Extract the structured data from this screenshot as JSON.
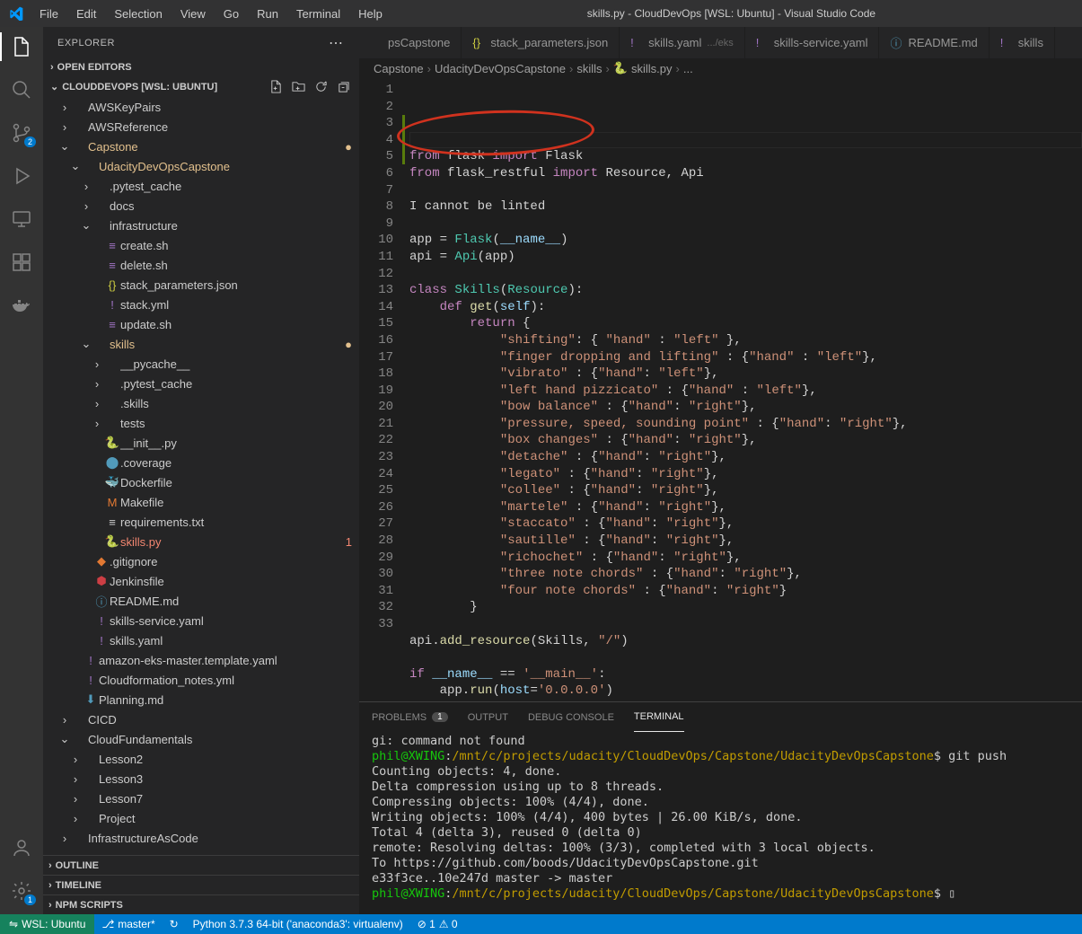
{
  "title": "skills.py - CloudDevOps [WSL: Ubuntu] - Visual Studio Code",
  "menu": [
    "File",
    "Edit",
    "Selection",
    "View",
    "Go",
    "Run",
    "Terminal",
    "Help"
  ],
  "activity": {
    "scm_badge": "2",
    "settings_badge": "1"
  },
  "sidebar": {
    "title": "EXPLORER",
    "open_editors": "OPEN EDITORS",
    "root": "CLOUDDEVOPS [WSL: UBUNTU]",
    "outline": "OUTLINE",
    "timeline": "TIMELINE",
    "npm": "NPM SCRIPTS",
    "tree": [
      {
        "d": 1,
        "t": "folder",
        "open": false,
        "name": "AWSKeyPairs"
      },
      {
        "d": 1,
        "t": "folder",
        "open": false,
        "name": "AWSReference"
      },
      {
        "d": 1,
        "t": "folder",
        "open": true,
        "name": "Capstone",
        "hl": "capstone",
        "mod": true
      },
      {
        "d": 2,
        "t": "folder",
        "open": true,
        "name": "UdacityDevOpsCapstone",
        "hl": "capstone"
      },
      {
        "d": 3,
        "t": "folder",
        "open": false,
        "name": ".pytest_cache"
      },
      {
        "d": 3,
        "t": "folder",
        "open": false,
        "name": "docs"
      },
      {
        "d": 3,
        "t": "folder",
        "open": true,
        "name": "infrastructure"
      },
      {
        "d": 4,
        "t": "file",
        "ic": "sh",
        "name": "create.sh"
      },
      {
        "d": 4,
        "t": "file",
        "ic": "sh",
        "name": "delete.sh"
      },
      {
        "d": 4,
        "t": "file",
        "ic": "json",
        "name": "stack_parameters.json"
      },
      {
        "d": 4,
        "t": "file",
        "ic": "yml",
        "name": "stack.yml"
      },
      {
        "d": 4,
        "t": "file",
        "ic": "sh",
        "name": "update.sh"
      },
      {
        "d": 3,
        "t": "folder",
        "open": true,
        "name": "skills",
        "hl": "skills",
        "mod": true
      },
      {
        "d": 4,
        "t": "folder",
        "open": false,
        "name": "__pycache__"
      },
      {
        "d": 4,
        "t": "folder",
        "open": false,
        "name": ".pytest_cache"
      },
      {
        "d": 4,
        "t": "folder",
        "open": false,
        "name": ".skills"
      },
      {
        "d": 4,
        "t": "folder",
        "open": false,
        "name": "tests"
      },
      {
        "d": 4,
        "t": "file",
        "ic": "py",
        "name": "__init__.py"
      },
      {
        "d": 4,
        "t": "file",
        "ic": "cov",
        "name": ".coverage"
      },
      {
        "d": 4,
        "t": "file",
        "ic": "dk",
        "name": "Dockerfile"
      },
      {
        "d": 4,
        "t": "file",
        "ic": "mk",
        "name": "Makefile"
      },
      {
        "d": 4,
        "t": "file",
        "ic": "txt",
        "name": "requirements.txt"
      },
      {
        "d": 4,
        "t": "file",
        "ic": "py",
        "name": "skills.py",
        "hl": "err",
        "badge": "1"
      },
      {
        "d": 3,
        "t": "file",
        "ic": "git",
        "name": ".gitignore"
      },
      {
        "d": 3,
        "t": "file",
        "ic": "jk",
        "name": "Jenkinsfile"
      },
      {
        "d": 3,
        "t": "file",
        "ic": "info",
        "name": "README.md"
      },
      {
        "d": 3,
        "t": "file",
        "ic": "yml",
        "name": "skills-service.yaml"
      },
      {
        "d": 3,
        "t": "file",
        "ic": "yml",
        "name": "skills.yaml"
      },
      {
        "d": 2,
        "t": "file",
        "ic": "yml",
        "name": "amazon-eks-master.template.yaml"
      },
      {
        "d": 2,
        "t": "file",
        "ic": "yml",
        "name": "Cloudformation_notes.yml"
      },
      {
        "d": 2,
        "t": "file",
        "ic": "md",
        "name": "Planning.md"
      },
      {
        "d": 1,
        "t": "folder",
        "open": false,
        "name": "CICD"
      },
      {
        "d": 1,
        "t": "folder",
        "open": true,
        "name": "CloudFundamentals"
      },
      {
        "d": 2,
        "t": "folder",
        "open": false,
        "name": "Lesson2"
      },
      {
        "d": 2,
        "t": "folder",
        "open": false,
        "name": "Lesson3"
      },
      {
        "d": 2,
        "t": "folder",
        "open": false,
        "name": "Lesson7"
      },
      {
        "d": 2,
        "t": "folder",
        "open": false,
        "name": "Project"
      },
      {
        "d": 1,
        "t": "folder",
        "open": false,
        "name": "InfrastructureAsCode"
      }
    ]
  },
  "tabs": [
    {
      "ic": "",
      "label": "psCapstone",
      "short": true
    },
    {
      "ic": "json",
      "label": "stack_parameters.json"
    },
    {
      "ic": "yml",
      "label": "skills.yaml",
      "desc": ".../eks"
    },
    {
      "ic": "yml",
      "label": "skills-service.yaml"
    },
    {
      "ic": "info",
      "label": "README.md"
    },
    {
      "ic": "yml",
      "label": "skills",
      "short": true
    }
  ],
  "breadcrumb": [
    "Capstone",
    "UdacityDevOpsCapstone",
    "skills",
    "skills.py",
    "..."
  ],
  "code": {
    "lines": 33,
    "content": [
      [
        [
          "kw",
          "from"
        ],
        [
          "",
          " flask "
        ],
        [
          "kw",
          "import"
        ],
        [
          "",
          " Flask"
        ]
      ],
      [
        [
          "kw",
          "from"
        ],
        [
          "",
          " flask_restful "
        ],
        [
          "kw",
          "import"
        ],
        [
          "",
          " Resource, Api"
        ]
      ],
      [],
      [
        [
          "",
          "I cannot be linted"
        ]
      ],
      [],
      [
        [
          "",
          "app "
        ],
        [
          "op",
          "="
        ],
        [
          "",
          " "
        ],
        [
          "cls",
          "Flask"
        ],
        [
          "op",
          "("
        ],
        [
          "var",
          "__name__"
        ],
        [
          "op",
          ")"
        ]
      ],
      [
        [
          "",
          "api "
        ],
        [
          "op",
          "="
        ],
        [
          "",
          " "
        ],
        [
          "cls",
          "Api"
        ],
        [
          "op",
          "("
        ],
        [
          "",
          "app"
        ],
        [
          "op",
          ")"
        ]
      ],
      [],
      [
        [
          "kw",
          "class"
        ],
        [
          "",
          " "
        ],
        [
          "cls",
          "Skills"
        ],
        [
          "op",
          "("
        ],
        [
          "cls",
          "Resource"
        ],
        [
          "op",
          "):"
        ]
      ],
      [
        [
          "",
          "    "
        ],
        [
          "kw",
          "def"
        ],
        [
          "",
          " "
        ],
        [
          "fn",
          "get"
        ],
        [
          "op",
          "("
        ],
        [
          "self",
          "self"
        ],
        [
          "op",
          "):"
        ]
      ],
      [
        [
          "",
          "        "
        ],
        [
          "kw",
          "return"
        ],
        [
          "",
          " {"
        ]
      ],
      [
        [
          "",
          "            "
        ],
        [
          "str",
          "\"shifting\""
        ],
        [
          "",
          ": { "
        ],
        [
          "str",
          "\"hand\""
        ],
        [
          "",
          " : "
        ],
        [
          "str",
          "\"left\""
        ],
        [
          "",
          " },"
        ]
      ],
      [
        [
          "",
          "            "
        ],
        [
          "str",
          "\"finger dropping and lifting\""
        ],
        [
          "",
          " : {"
        ],
        [
          "str",
          "\"hand\""
        ],
        [
          "",
          " : "
        ],
        [
          "str",
          "\"left\""
        ],
        [
          "",
          "},"
        ]
      ],
      [
        [
          "",
          "            "
        ],
        [
          "str",
          "\"vibrato\""
        ],
        [
          "",
          " : {"
        ],
        [
          "str",
          "\"hand\""
        ],
        [
          "",
          ": "
        ],
        [
          "str",
          "\"left\""
        ],
        [
          "",
          "},"
        ]
      ],
      [
        [
          "",
          "            "
        ],
        [
          "str",
          "\"left hand pizzicato\""
        ],
        [
          "",
          " : {"
        ],
        [
          "str",
          "\"hand\""
        ],
        [
          "",
          " : "
        ],
        [
          "str",
          "\"left\""
        ],
        [
          "",
          "},"
        ]
      ],
      [
        [
          "",
          "            "
        ],
        [
          "str",
          "\"bow balance\""
        ],
        [
          "",
          " : {"
        ],
        [
          "str",
          "\"hand\""
        ],
        [
          "",
          ": "
        ],
        [
          "str",
          "\"right\""
        ],
        [
          "",
          "},"
        ]
      ],
      [
        [
          "",
          "            "
        ],
        [
          "str",
          "\"pressure, speed, sounding point\""
        ],
        [
          "",
          " : {"
        ],
        [
          "str",
          "\"hand\""
        ],
        [
          "",
          ": "
        ],
        [
          "str",
          "\"right\""
        ],
        [
          "",
          "},"
        ]
      ],
      [
        [
          "",
          "            "
        ],
        [
          "str",
          "\"box changes\""
        ],
        [
          "",
          " : {"
        ],
        [
          "str",
          "\"hand\""
        ],
        [
          "",
          ": "
        ],
        [
          "str",
          "\"right\""
        ],
        [
          "",
          "},"
        ]
      ],
      [
        [
          "",
          "            "
        ],
        [
          "str",
          "\"detache\""
        ],
        [
          "",
          " : {"
        ],
        [
          "str",
          "\"hand\""
        ],
        [
          "",
          ": "
        ],
        [
          "str",
          "\"right\""
        ],
        [
          "",
          "},"
        ]
      ],
      [
        [
          "",
          "            "
        ],
        [
          "str",
          "\"legato\""
        ],
        [
          "",
          " : {"
        ],
        [
          "str",
          "\"hand\""
        ],
        [
          "",
          ": "
        ],
        [
          "str",
          "\"right\""
        ],
        [
          "",
          "},"
        ]
      ],
      [
        [
          "",
          "            "
        ],
        [
          "str",
          "\"collee\""
        ],
        [
          "",
          " : {"
        ],
        [
          "str",
          "\"hand\""
        ],
        [
          "",
          ": "
        ],
        [
          "str",
          "\"right\""
        ],
        [
          "",
          "},"
        ]
      ],
      [
        [
          "",
          "            "
        ],
        [
          "str",
          "\"martele\""
        ],
        [
          "",
          " : {"
        ],
        [
          "str",
          "\"hand\""
        ],
        [
          "",
          ": "
        ],
        [
          "str",
          "\"right\""
        ],
        [
          "",
          "},"
        ]
      ],
      [
        [
          "",
          "            "
        ],
        [
          "str",
          "\"staccato\""
        ],
        [
          "",
          " : {"
        ],
        [
          "str",
          "\"hand\""
        ],
        [
          "",
          ": "
        ],
        [
          "str",
          "\"right\""
        ],
        [
          "",
          "},"
        ]
      ],
      [
        [
          "",
          "            "
        ],
        [
          "str",
          "\"sautille\""
        ],
        [
          "",
          " : {"
        ],
        [
          "str",
          "\"hand\""
        ],
        [
          "",
          ": "
        ],
        [
          "str",
          "\"right\""
        ],
        [
          "",
          "},"
        ]
      ],
      [
        [
          "",
          "            "
        ],
        [
          "str",
          "\"richochet\""
        ],
        [
          "",
          " : {"
        ],
        [
          "str",
          "\"hand\""
        ],
        [
          "",
          ": "
        ],
        [
          "str",
          "\"right\""
        ],
        [
          "",
          "},"
        ]
      ],
      [
        [
          "",
          "            "
        ],
        [
          "str",
          "\"three note chords\""
        ],
        [
          "",
          " : {"
        ],
        [
          "str",
          "\"hand\""
        ],
        [
          "",
          ": "
        ],
        [
          "str",
          "\"right\""
        ],
        [
          "",
          "},"
        ]
      ],
      [
        [
          "",
          "            "
        ],
        [
          "str",
          "\"four note chords\""
        ],
        [
          "",
          " : {"
        ],
        [
          "str",
          "\"hand\""
        ],
        [
          "",
          ": "
        ],
        [
          "str",
          "\"right\""
        ],
        [
          "",
          "}"
        ]
      ],
      [
        [
          "",
          "        }"
        ]
      ],
      [],
      [
        [
          "",
          "api."
        ],
        [
          "fn",
          "add_resource"
        ],
        [
          "op",
          "("
        ],
        [
          "",
          "Skills, "
        ],
        [
          "str",
          "\"/\""
        ],
        [
          "op",
          ")"
        ]
      ],
      [],
      [
        [
          "kw",
          "if"
        ],
        [
          "",
          " "
        ],
        [
          "var",
          "__name__"
        ],
        [
          "",
          " "
        ],
        [
          "op",
          "=="
        ],
        [
          "",
          " "
        ],
        [
          "str",
          "'__main__'"
        ],
        [
          "",
          ":"
        ]
      ],
      [
        [
          "",
          "    app."
        ],
        [
          "fn",
          "run"
        ],
        [
          "op",
          "("
        ],
        [
          "var",
          "host"
        ],
        [
          "op",
          "="
        ],
        [
          "str",
          "'0.0.0.0'"
        ],
        [
          "op",
          ")"
        ]
      ]
    ]
  },
  "panel": {
    "tabs": [
      {
        "label": "PROBLEMS",
        "badge": "1"
      },
      {
        "label": "OUTPUT"
      },
      {
        "label": "DEBUG CONSOLE"
      },
      {
        "label": "TERMINAL",
        "active": true
      }
    ],
    "terminal": [
      {
        "segs": [
          [
            "w",
            "gi: command not found"
          ]
        ]
      },
      {
        "segs": [
          [
            "g",
            "phil@XWING"
          ],
          [
            "w",
            ":"
          ],
          [
            "y",
            "/mnt/c/projects/udacity/CloudDevOps/Capstone/UdacityDevOpsCapstone"
          ],
          [
            "w",
            "$ git push"
          ]
        ]
      },
      {
        "segs": [
          [
            "w",
            "Counting objects: 4, done."
          ]
        ]
      },
      {
        "segs": [
          [
            "w",
            "Delta compression using up to 8 threads."
          ]
        ]
      },
      {
        "segs": [
          [
            "w",
            "Compressing objects: 100% (4/4), done."
          ]
        ]
      },
      {
        "segs": [
          [
            "w",
            "Writing objects: 100% (4/4), 400 bytes | 26.00 KiB/s, done."
          ]
        ]
      },
      {
        "segs": [
          [
            "w",
            "Total 4 (delta 3), reused 0 (delta 0)"
          ]
        ]
      },
      {
        "segs": [
          [
            "w",
            "remote: Resolving deltas: 100% (3/3), completed with 3 local objects."
          ]
        ]
      },
      {
        "segs": [
          [
            "w",
            "To https://github.com/boods/UdacityDevOpsCapstone.git"
          ]
        ]
      },
      {
        "segs": [
          [
            "w",
            "   e33f3ce..10e247d  master -> master"
          ]
        ]
      },
      {
        "segs": [
          [
            "g",
            "phil@XWING"
          ],
          [
            "w",
            ":"
          ],
          [
            "y",
            "/mnt/c/projects/udacity/CloudDevOps/Capstone/UdacityDevOpsCapstone"
          ],
          [
            "w",
            "$ "
          ],
          [
            "w",
            "▯"
          ]
        ]
      }
    ]
  },
  "status": {
    "remote": "WSL: Ubuntu",
    "branch": "master*",
    "sync": "↻",
    "python": "Python 3.7.3 64-bit ('anaconda3': virtualenv)",
    "errors": "⊘ 1",
    "warnings": "⚠ 0"
  }
}
